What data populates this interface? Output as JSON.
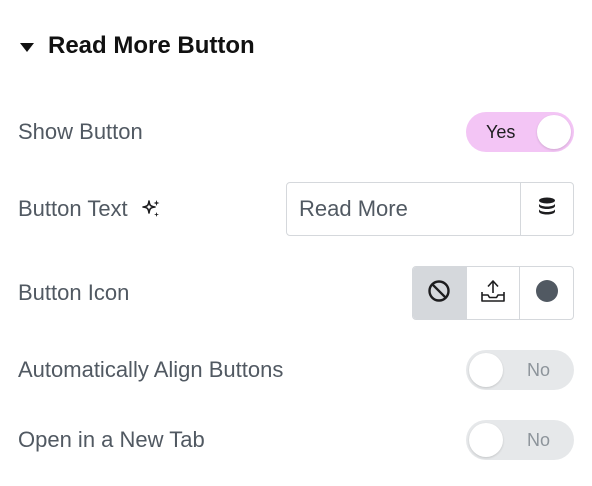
{
  "section": {
    "title": "Read More Button"
  },
  "show_button": {
    "label": "Show Button",
    "toggle_label": "Yes",
    "state": "on"
  },
  "button_text": {
    "label": "Button Text",
    "value": "Read More"
  },
  "button_icon": {
    "label": "Button Icon",
    "options": [
      "none-icon",
      "upload-icon",
      "circle-icon"
    ],
    "selected": "none-icon"
  },
  "auto_align": {
    "label": "Automatically Align Buttons",
    "toggle_label": "No",
    "state": "off"
  },
  "new_tab": {
    "label": "Open in a New Tab",
    "toggle_label": "No",
    "state": "off"
  },
  "colors": {
    "toggle_on": "#f3c5f5",
    "toggle_off": "#e6e8ea",
    "label_text": "#515962",
    "active_option": "#d5d8dc"
  }
}
